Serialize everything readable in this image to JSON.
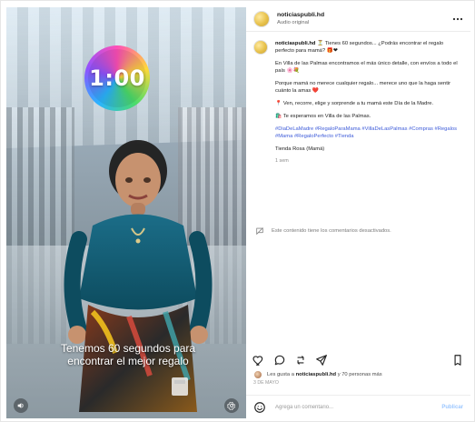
{
  "video": {
    "timer_text": "1:00",
    "subtitle_line1": "Tenemos 60 segundos para",
    "subtitle_line2": "encontrar el mejor regalo"
  },
  "post": {
    "header": {
      "username": "noticiaspubli.hd",
      "audio": "Audio original"
    },
    "caption": {
      "username": "noticiaspubli.hd",
      "line1": "⏳ Tienes 60 segundos... ¿Podrás encontrar el regalo perfecto para mamá? 🎁❤",
      "line2": "En Villa de las Palmas encontramos el más único detalle, con envíos a todo el país 🌸💐",
      "line3": "Porque mamá no merece cualquier regalo... merece uno que la haga sentir cuánto la amas ❤️",
      "line4": "📍 Ven, recorre, elige y sorprende a tu mamá este Día de la Madre.",
      "line5": "🛍️ Te esperamos en Villa de las Palmas.",
      "tags": "#DiaDeLaMadre #RegaloParaMama #VillaDeLasPalmas #Compras #Regalos #Mama #RegaloPerfecto #Tienda",
      "tagline": "Tienda Rosa (Mamá)",
      "age": "1 sem"
    },
    "comment_notice": "Este contenido tiene los comentarios desactivados.",
    "likes": {
      "prefix": "Les gusta a",
      "user": "noticiaspubli.hd",
      "suffix": "y 70 personas más"
    },
    "date": "3 DE MAYO",
    "compose": {
      "placeholder": "Agrega un comentario...",
      "post_label": "Publicar"
    }
  }
}
